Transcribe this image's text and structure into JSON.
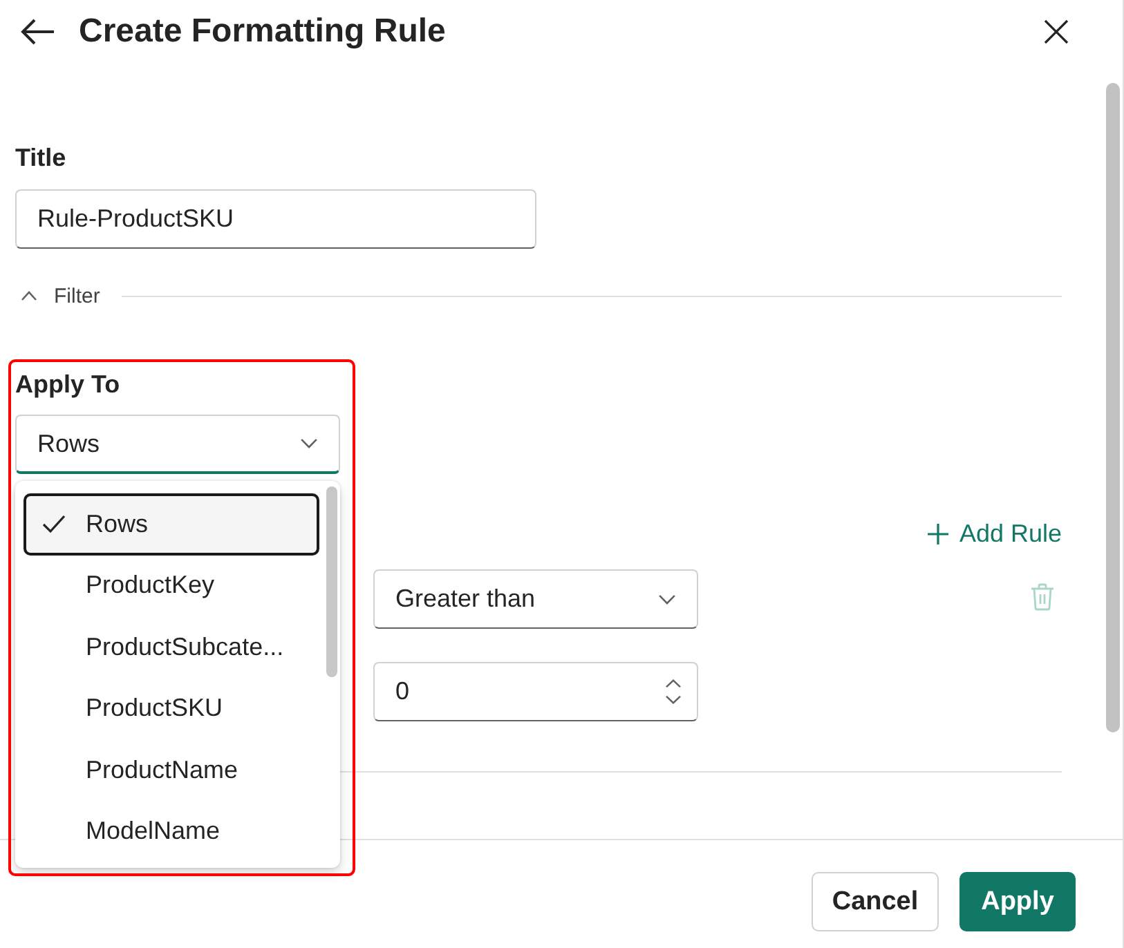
{
  "header": {
    "title": "Create Formatting Rule"
  },
  "title_field": {
    "label": "Title",
    "value": "Rule-ProductSKU"
  },
  "filter_section": {
    "label": "Filter",
    "expanded": true
  },
  "apply_to": {
    "label": "Apply To",
    "value": "Rows",
    "open": true,
    "options": [
      {
        "label": "Rows",
        "selected": true
      },
      {
        "label": "ProductKey",
        "selected": false
      },
      {
        "label": "ProductSubcate...",
        "selected": false
      },
      {
        "label": "ProductSKU",
        "selected": false
      },
      {
        "label": "ProductName",
        "selected": false
      },
      {
        "label": "ModelName",
        "selected": false
      }
    ]
  },
  "rules": {
    "add_label": "Add Rule",
    "rows": [
      {
        "operator": "Greater than",
        "value": "0",
        "delete_disabled": true
      }
    ]
  },
  "footer": {
    "buttons": [
      {
        "label": "Cancel",
        "kind": "secondary"
      },
      {
        "label": "Apply",
        "kind": "primary"
      }
    ]
  }
}
